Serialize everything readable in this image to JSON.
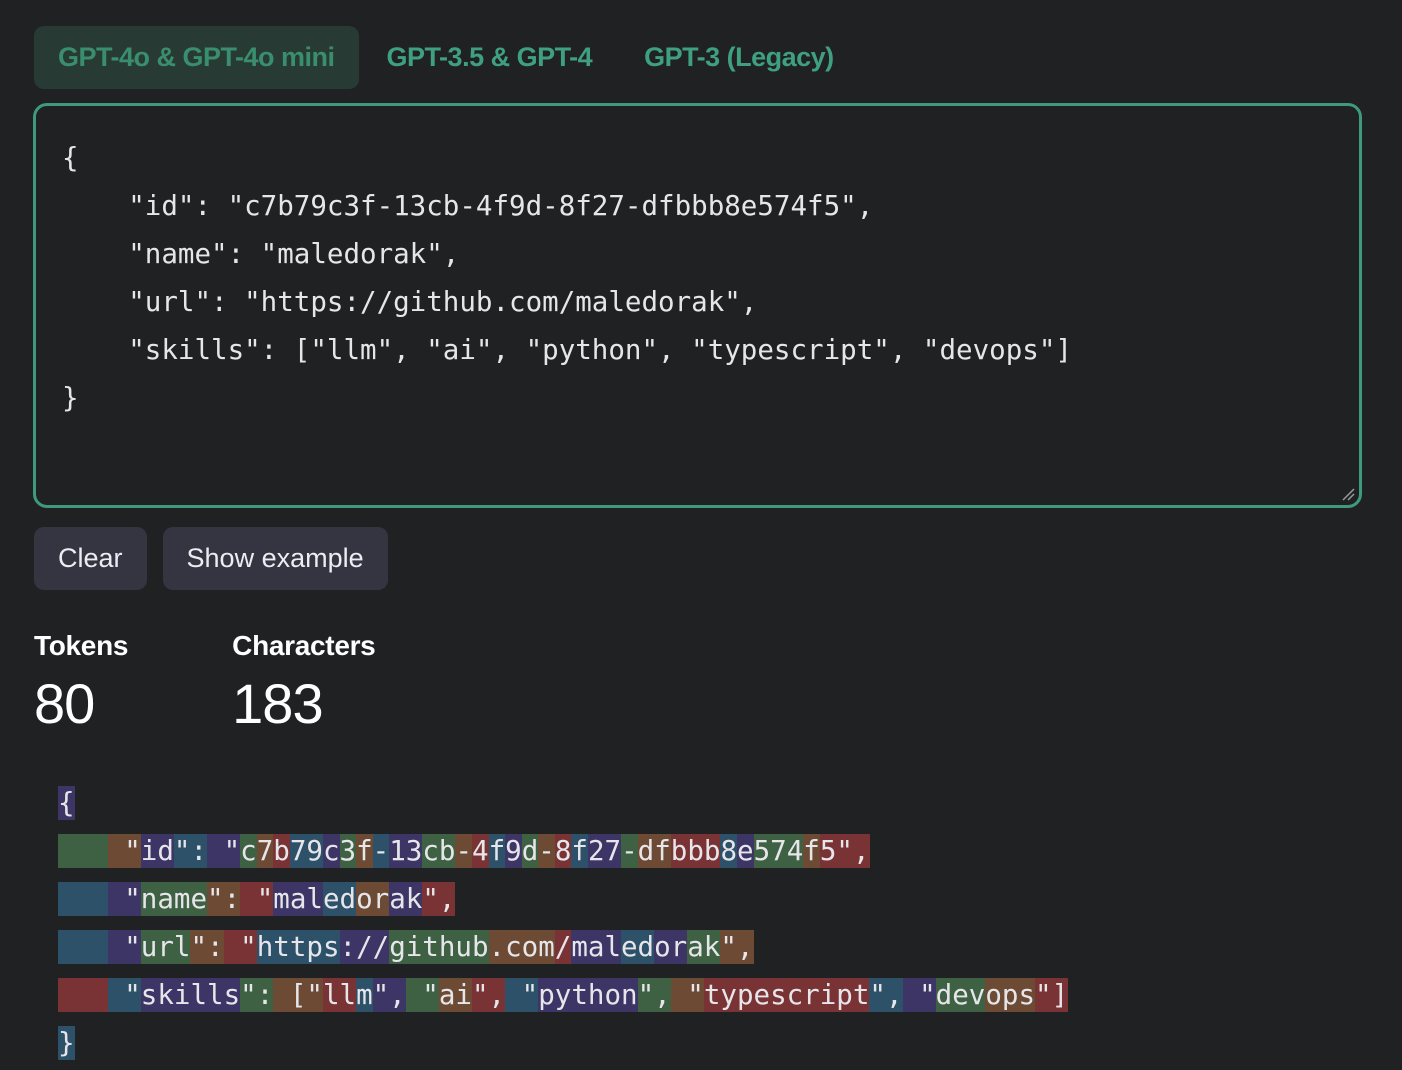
{
  "tabs": [
    {
      "label": "GPT-4o & GPT-4o mini",
      "active": true
    },
    {
      "label": "GPT-3.5 & GPT-4",
      "active": false
    },
    {
      "label": "GPT-3 (Legacy)",
      "active": false
    }
  ],
  "editor": {
    "lines": [
      "{",
      "    \"id\": \"c7b79c3f-13cb-4f9d-8f27-dfbbb8e574f5\",",
      "    \"name\": \"maledorak\",",
      "    \"url\": \"https://github.com/maledorak\",",
      "    \"skills\": [\"llm\", \"ai\", \"python\", \"typescript\", \"devops\"]",
      "}"
    ]
  },
  "buttons": {
    "clear_label": "Clear",
    "example_label": "Show example"
  },
  "stats": {
    "tokens_label": "Tokens",
    "tokens_value": "80",
    "characters_label": "Characters",
    "characters_value": "183"
  },
  "token_colors": [
    "#3c3566",
    "#3f6143",
    "#6d4a33",
    "#7a3334",
    "#2c5169"
  ],
  "tokenized": {
    "lines": [
      [
        [
          "{",
          0
        ]
      ],
      [
        [
          "   ",
          1
        ],
        [
          " \"",
          2
        ],
        [
          "id",
          0
        ],
        [
          "\":",
          4
        ],
        [
          " \"",
          0
        ],
        [
          "c",
          1
        ],
        [
          "7",
          2
        ],
        [
          "b",
          3
        ],
        [
          "79",
          4
        ],
        [
          "c",
          0
        ],
        [
          "3",
          1
        ],
        [
          "f",
          2
        ],
        [
          "-",
          4
        ],
        [
          "13",
          0
        ],
        [
          "cb",
          1
        ],
        [
          "-",
          2
        ],
        [
          "4",
          3
        ],
        [
          "f",
          4
        ],
        [
          "9",
          0
        ],
        [
          "d",
          1
        ],
        [
          "-",
          2
        ],
        [
          "8",
          3
        ],
        [
          "f",
          4
        ],
        [
          "27",
          0
        ],
        [
          "-",
          1
        ],
        [
          "df",
          2
        ],
        [
          "bbb",
          3
        ],
        [
          "8",
          4
        ],
        [
          "e",
          0
        ],
        [
          "574",
          1
        ],
        [
          "f",
          2
        ],
        [
          "5",
          3
        ],
        [
          "\",",
          3
        ]
      ],
      [
        [
          "   ",
          4
        ],
        [
          " \"",
          0
        ],
        [
          "name",
          1
        ],
        [
          "\":",
          2
        ],
        [
          " \"",
          3
        ],
        [
          "mal",
          0
        ],
        [
          "ed",
          4
        ],
        [
          "or",
          2
        ],
        [
          "ak",
          0
        ],
        [
          "\",",
          3
        ]
      ],
      [
        [
          "   ",
          4
        ],
        [
          " \"",
          0
        ],
        [
          "url",
          1
        ],
        [
          "\":",
          2
        ],
        [
          " \"",
          3
        ],
        [
          "https",
          4
        ],
        [
          "://",
          0
        ],
        [
          "github",
          1
        ],
        [
          ".com",
          2
        ],
        [
          "/",
          3
        ],
        [
          "mal",
          0
        ],
        [
          "ed",
          4
        ],
        [
          "or",
          0
        ],
        [
          "ak",
          1
        ],
        [
          "\",",
          2
        ]
      ],
      [
        [
          "   ",
          3
        ],
        [
          " \"",
          4
        ],
        [
          "skills",
          0
        ],
        [
          "\":",
          1
        ],
        [
          " [\"",
          2
        ],
        [
          "ll",
          3
        ],
        [
          "m",
          4
        ],
        [
          "\",",
          0
        ],
        [
          " \"",
          1
        ],
        [
          "ai",
          2
        ],
        [
          "\",",
          3
        ],
        [
          " \"",
          4
        ],
        [
          "python",
          0
        ],
        [
          "\",",
          1
        ],
        [
          " \"",
          2
        ],
        [
          "typescript",
          3
        ],
        [
          "\",",
          4
        ],
        [
          " \"",
          0
        ],
        [
          "dev",
          1
        ],
        [
          "ops",
          2
        ],
        [
          "\"]",
          3
        ]
      ],
      [
        [
          "}",
          4
        ]
      ]
    ]
  }
}
